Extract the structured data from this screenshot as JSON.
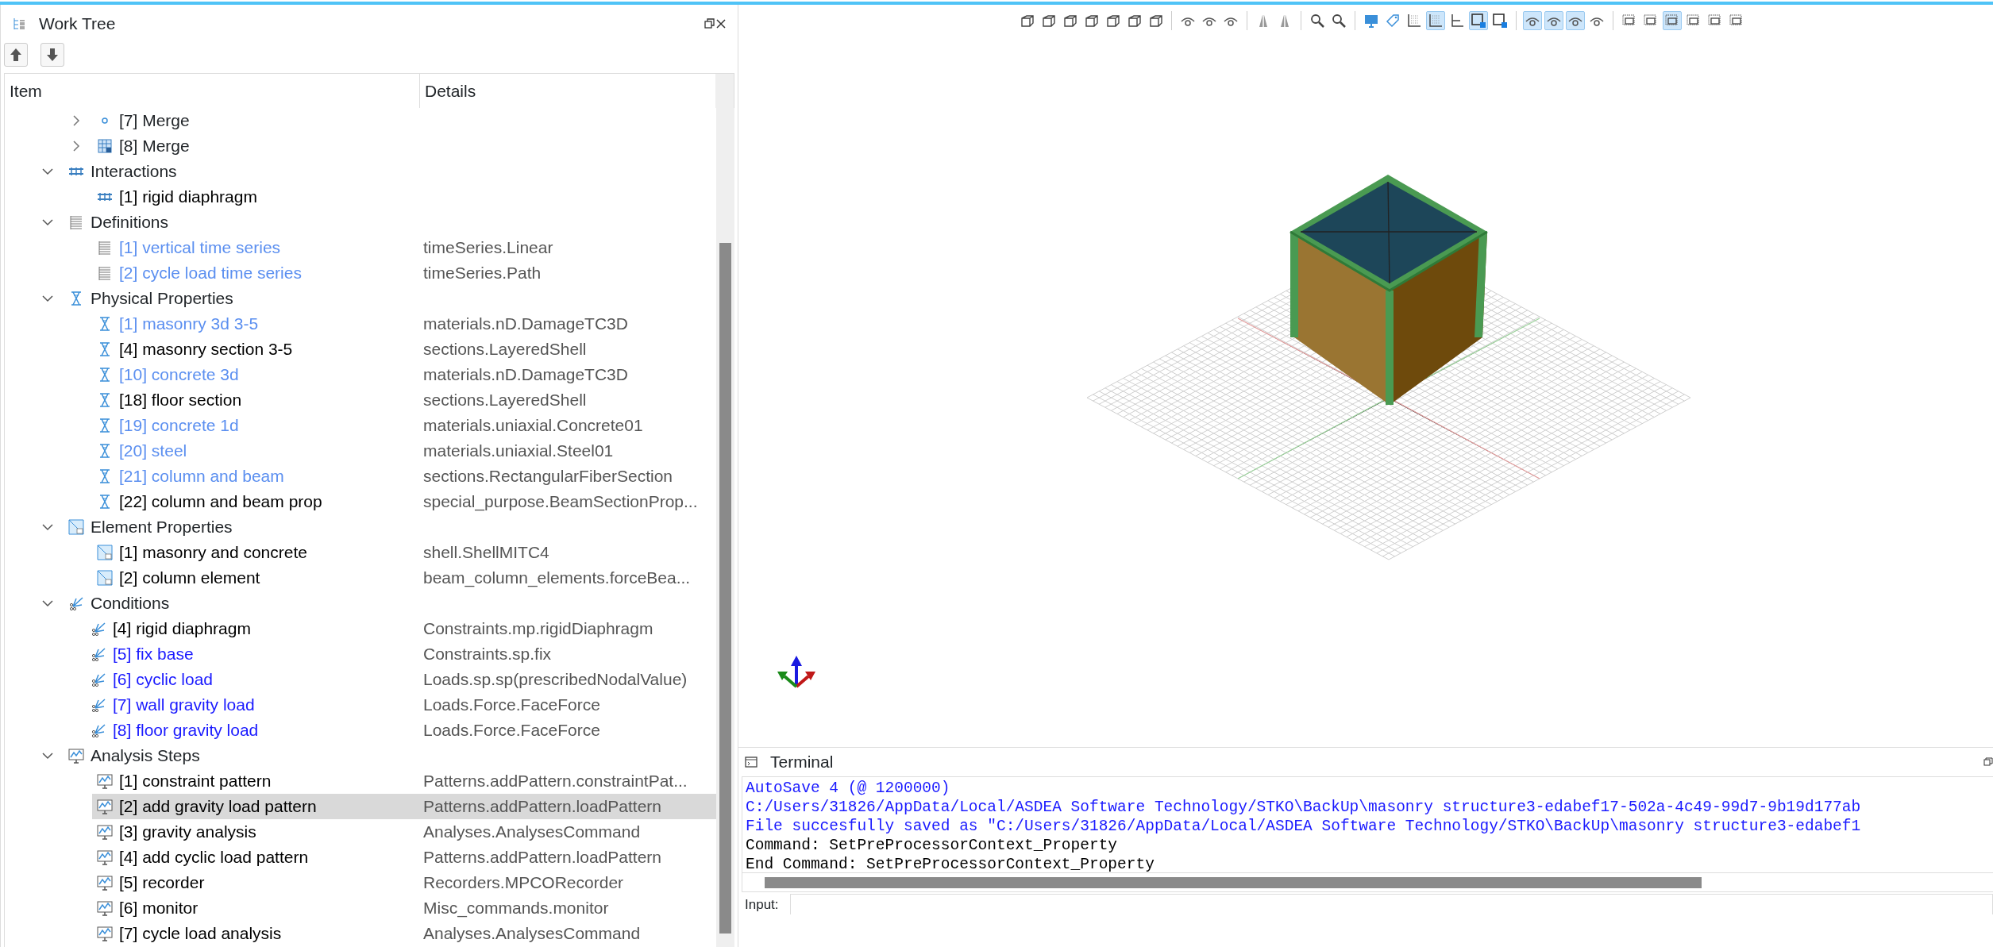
{
  "panel": {
    "title": "Work Tree",
    "buttons": [
      {
        "kind": "up"
      },
      {
        "kind": "down"
      }
    ]
  },
  "tree": {
    "columns": [
      "Item",
      "Details"
    ],
    "continued_items": [
      {
        "label": "[7] Merge",
        "kind": "merge-dot",
        "expanded": false,
        "selected": false
      },
      {
        "label": "[8] Merge",
        "kind": "merge-grid",
        "expanded": false,
        "selected": false
      }
    ],
    "groups": [
      {
        "label": "Interactions",
        "kind": "interaction",
        "expanded": true,
        "selected": false,
        "children": [
          {
            "label": "[1] rigid diaphragm",
            "kind": "interaction",
            "color": "#000000",
            "selected": false
          }
        ]
      },
      {
        "label": "Definitions",
        "kind": "definition",
        "expanded": true,
        "selected": false,
        "children": [
          {
            "label": "[1] vertical time series",
            "details": "timeSeries.Linear",
            "kind": "definition",
            "color": "#5b8ff0",
            "selected": false
          },
          {
            "label": "[2] cycle load time series",
            "details": "timeSeries.Path",
            "kind": "definition",
            "color": "#5b8ff0",
            "selected": false
          }
        ]
      },
      {
        "label": "Physical Properties",
        "kind": "physical",
        "expanded": true,
        "selected": false,
        "children": [
          {
            "label": "[1] masonry 3d 3-5",
            "details": "materials.nD.DamageTC3D",
            "kind": "physical",
            "color": "#5b8ff0",
            "selected": false
          },
          {
            "label": "[4] masonry section 3-5",
            "details": "sections.LayeredShell",
            "kind": "physical",
            "color": "#000000",
            "selected": false
          },
          {
            "label": "[10] concrete 3d",
            "details": "materials.nD.DamageTC3D",
            "kind": "physical",
            "color": "#5b8ff0",
            "selected": false
          },
          {
            "label": "[18] floor section",
            "details": "sections.LayeredShell",
            "kind": "physical",
            "color": "#000000",
            "selected": false
          },
          {
            "label": "[19] concrete 1d",
            "details": "materials.uniaxial.Concrete01",
            "kind": "physical",
            "color": "#5b8ff0",
            "selected": false
          },
          {
            "label": "[20] steel",
            "details": "materials.uniaxial.Steel01",
            "kind": "physical",
            "color": "#5b8ff0",
            "selected": false
          },
          {
            "label": "[21] column and beam",
            "details": "sections.RectangularFiberSection",
            "kind": "physical",
            "color": "#5b8ff0",
            "selected": false
          },
          {
            "label": "[22] column and beam prop",
            "details": "special_purpose.BeamSectionProp...",
            "kind": "physical",
            "color": "#000000",
            "selected": false
          }
        ]
      },
      {
        "label": "Element Properties",
        "kind": "element",
        "expanded": true,
        "selected": false,
        "children": [
          {
            "label": "[1] masonry and concrete",
            "details": "shell.ShellMITC4",
            "kind": "element",
            "color": "#000000",
            "selected": false
          },
          {
            "label": "[2] column element",
            "details": "beam_column_elements.forceBea...",
            "kind": "element",
            "color": "#000000",
            "selected": false
          }
        ]
      },
      {
        "label": "Conditions",
        "kind": "condition",
        "expanded": true,
        "selected": false,
        "children": [
          {
            "label": "[4] rigid diaphragm",
            "details": "Constraints.mp.rigidDiaphragm",
            "kind": "condition",
            "color": "#000000",
            "selected": false
          },
          {
            "label": "[5] fix base",
            "details": "Constraints.sp.fix",
            "kind": "condition",
            "color": "#1a1aff",
            "selected": false
          },
          {
            "label": "[6] cyclic load",
            "details": "Loads.sp.sp(prescribedNodalValue)",
            "kind": "condition",
            "color": "#1a1aff",
            "selected": false
          },
          {
            "label": "[7] wall gravity load",
            "details": "Loads.Force.FaceForce",
            "kind": "condition",
            "color": "#1a1aff",
            "selected": false
          },
          {
            "label": "[8] floor gravity load",
            "details": "Loads.Force.FaceForce",
            "kind": "condition",
            "color": "#1a1aff",
            "selected": false
          }
        ]
      },
      {
        "label": "Analysis Steps",
        "kind": "analysis",
        "expanded": true,
        "selected": false,
        "children": [
          {
            "label": "[1] constraint pattern",
            "details": "Patterns.addPattern.constraintPat...",
            "kind": "analysis",
            "color": "#000000",
            "selected": false
          },
          {
            "label": "[2] add gravity load pattern",
            "details": "Patterns.addPattern.loadPattern",
            "kind": "analysis",
            "color": "#000000",
            "selected": true
          },
          {
            "label": "[3] gravity analysis",
            "details": "Analyses.AnalysesCommand",
            "kind": "analysis",
            "color": "#000000",
            "selected": false
          },
          {
            "label": "[4] add cyclic load pattern",
            "details": "Patterns.addPattern.loadPattern",
            "kind": "analysis",
            "color": "#000000",
            "selected": false
          },
          {
            "label": "[5] recorder",
            "details": "Recorders.MPCORecorder",
            "kind": "analysis",
            "color": "#000000",
            "selected": false
          },
          {
            "label": "[6] monitor",
            "details": "Misc_commands.monitor",
            "kind": "analysis",
            "color": "#000000",
            "selected": false
          },
          {
            "label": "[7] cycle load analysis",
            "details": "Analyses.AnalysesCommand",
            "kind": "analysis",
            "color": "#000000",
            "selected": false
          }
        ]
      }
    ]
  },
  "toolbar": {
    "groups": [
      [
        {
          "kind": "cube",
          "selected": false
        },
        {
          "kind": "cube",
          "selected": false
        },
        {
          "kind": "cube",
          "selected": false
        },
        {
          "kind": "cube",
          "selected": false
        },
        {
          "kind": "cube",
          "selected": false
        },
        {
          "kind": "cube",
          "selected": false
        },
        {
          "kind": "cube",
          "selected": false
        }
      ],
      [
        {
          "kind": "eye",
          "selected": false
        },
        {
          "kind": "eye",
          "selected": false
        },
        {
          "kind": "eye",
          "selected": false
        }
      ],
      [
        {
          "kind": "split",
          "selected": false
        },
        {
          "kind": "split",
          "selected": false
        }
      ],
      [
        {
          "kind": "zoom",
          "selected": false
        },
        {
          "kind": "zoom",
          "selected": false
        }
      ],
      [
        {
          "kind": "monitor",
          "selected": false
        },
        {
          "kind": "tag",
          "selected": false
        },
        {
          "kind": "grid",
          "selected": false
        },
        {
          "kind": "grid",
          "selected": true
        },
        {
          "kind": "axes",
          "selected": false
        },
        {
          "kind": "square",
          "selected": true
        },
        {
          "kind": "square",
          "selected": false
        }
      ],
      [
        {
          "kind": "eye",
          "selected": true
        },
        {
          "kind": "eye",
          "selected": true
        },
        {
          "kind": "eye",
          "selected": true
        },
        {
          "kind": "eye",
          "selected": false
        }
      ],
      [
        {
          "kind": "layer",
          "selected": false
        },
        {
          "kind": "layer",
          "selected": false
        },
        {
          "kind": "layer",
          "selected": true
        },
        {
          "kind": "layer",
          "selected": false
        },
        {
          "kind": "layer",
          "selected": false
        },
        {
          "kind": "layer",
          "selected": false
        }
      ]
    ]
  },
  "terminal": {
    "title": "Terminal",
    "lines": [
      {
        "text": "AutoSave 4 (@ 1200000)",
        "color": "#1a1aff"
      },
      {
        "text": "C:/Users/31826/AppData/Local/ASDEA Software Technology/STKO\\BackUp\\masonry structure3-edabef17-502a-4c49-99d7-9b19d177ab",
        "color": "#1a1aff"
      },
      {
        "text": "File succesfully saved as \"C:/Users/31826/AppData/Local/ASDEA Software Technology/STKO\\BackUp\\masonry structure3-edabef1",
        "color": "#1a1aff"
      },
      {
        "text": "Command: SetPreProcessorContext_Property",
        "color": "#000000"
      },
      {
        "text": "End Command: SetPreProcessorContext_Property",
        "color": "#000000"
      }
    ],
    "input_label": "Input:"
  }
}
